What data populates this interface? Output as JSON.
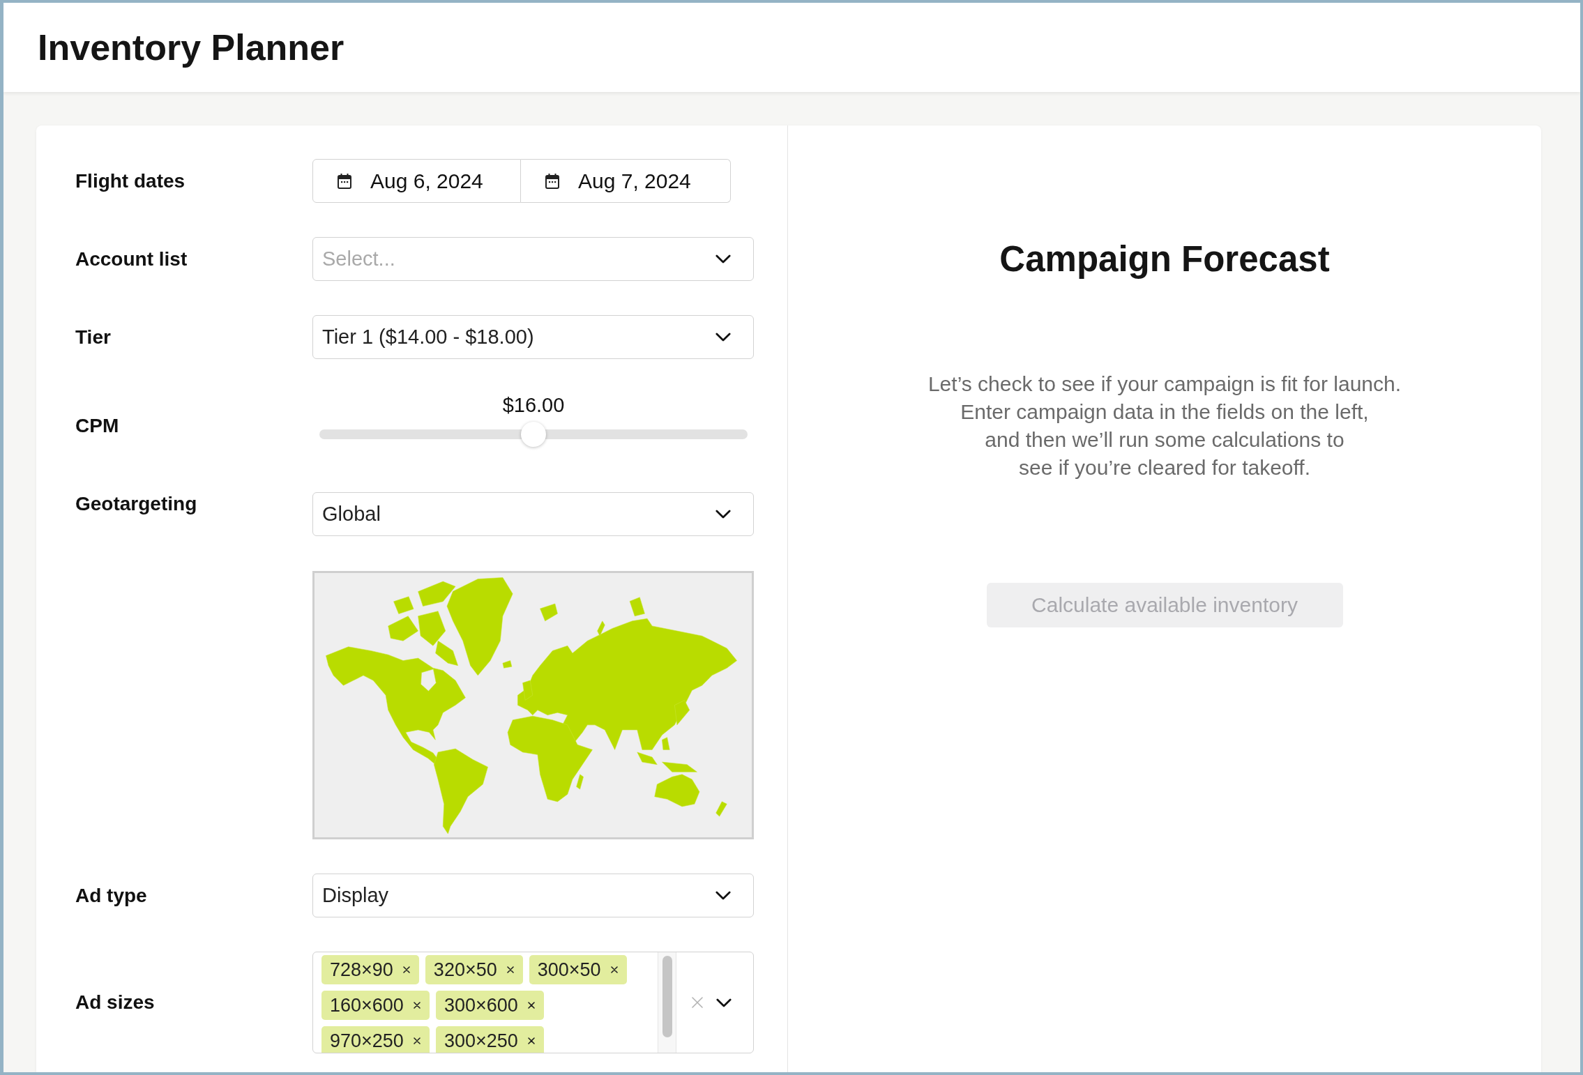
{
  "header": {
    "title": "Inventory Planner"
  },
  "form": {
    "fields": [
      {
        "kind": "daterange",
        "label": "Flight dates",
        "start": "Aug 6, 2024",
        "end": "Aug 7, 2024"
      },
      {
        "kind": "select",
        "label": "Account list",
        "placeholder": "Select..."
      },
      {
        "kind": "select",
        "label": "Tier",
        "value": "Tier 1 ($14.00 - $18.00)"
      },
      {
        "kind": "slider",
        "label": "CPM",
        "reading": "$16.00",
        "level": 0.5
      },
      {
        "kind": "mapselect",
        "label": "Geotargeting",
        "value": "Global"
      },
      {
        "kind": "select",
        "label": "Ad type",
        "value": "Display"
      },
      {
        "kind": "multiselect",
        "label": "Ad sizes",
        "tags": [
          "728×90",
          "320×50",
          "300×50",
          "160×600",
          "300×600",
          "970×250",
          "300×250"
        ]
      }
    ]
  },
  "forecast": {
    "title": "Campaign Forecast",
    "message": "Let’s check to see if your campaign is fit for launch.\nEnter campaign data in the fields on the left,\nand then we’ll run some calculations to\nsee if you’re cleared for takeoff.",
    "button": {
      "label": "Calculate available inventory",
      "disabled": true
    }
  }
}
